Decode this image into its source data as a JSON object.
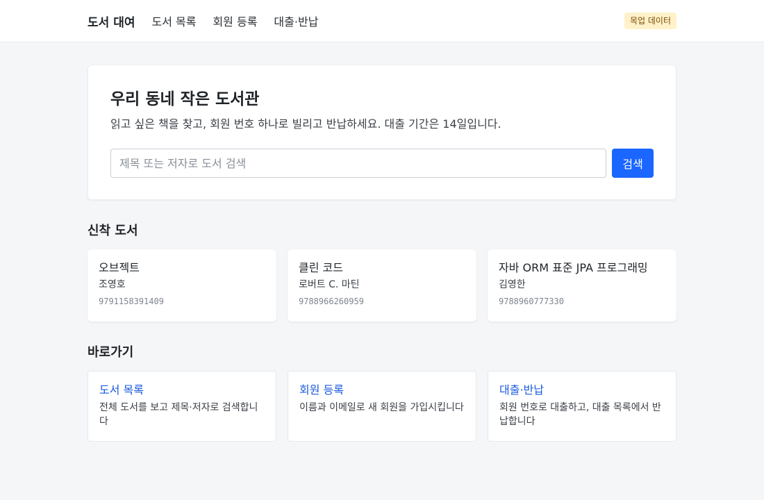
{
  "nav": {
    "brand": "도서 대여",
    "links": [
      "도서 목록",
      "회원 등록",
      "대출·반납"
    ],
    "badge": "목업 데이터"
  },
  "hero": {
    "title": "우리 동네 작은 도서관",
    "description": "읽고 싶은 책을 찾고, 회원 번호 하나로 빌리고 반납하세요. 대출 기간은 14일입니다.",
    "search_placeholder": "제목 또는 저자로 도서 검색",
    "search_value": "",
    "search_button": "검색"
  },
  "new_books": {
    "title": "신착 도서",
    "items": [
      {
        "title": "오브젝트",
        "author": "조영호",
        "isbn": "9791158391409"
      },
      {
        "title": "클린 코드",
        "author": "로버트 C. 마틴",
        "isbn": "9788966260959"
      },
      {
        "title": "자바 ORM 표준 JPA 프로그래밍",
        "author": "김영한",
        "isbn": "9788960777330"
      }
    ]
  },
  "shortcuts": {
    "title": "바로가기",
    "items": [
      {
        "title": "도서 목록",
        "description": "전체 도서를 보고 제목·저자로 검색합니다"
      },
      {
        "title": "회원 등록",
        "description": "이름과 이메일로 새 회원을 가입시킵니다"
      },
      {
        "title": "대출·반납",
        "description": "회원 번호로 대출하고, 대출 목록에서 반납합니다"
      }
    ]
  },
  "colors": {
    "accent": "#1a66ff",
    "link": "#1a5adf",
    "badge_bg": "#fff1c9",
    "page_bg": "#f5f6f8"
  }
}
